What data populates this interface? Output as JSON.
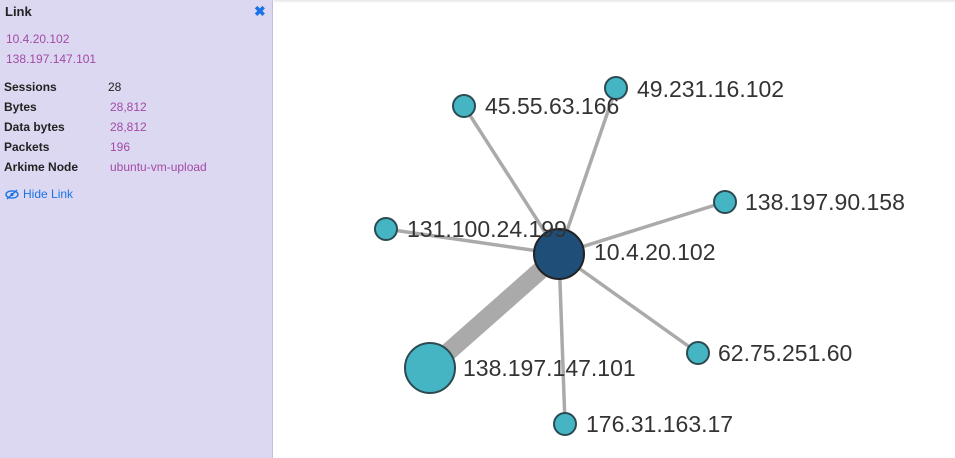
{
  "panel": {
    "title": "Link",
    "close_icon": "close-icon",
    "source_ip": "10.4.20.102",
    "dest_ip": "138.197.147.101",
    "rows": [
      {
        "label": "Sessions",
        "value": "28"
      },
      {
        "label": "Bytes",
        "value": "28,812"
      },
      {
        "label": "Data bytes",
        "value": "28,812"
      },
      {
        "label": "Packets",
        "value": "196"
      },
      {
        "label": "Arkime Node",
        "value": "ubuntu-vm-upload"
      }
    ],
    "hide_link": {
      "icon": "eye-slash-icon",
      "label": "Hide Link"
    }
  },
  "graph": {
    "center_node": {
      "label": "10.4.20.102",
      "color": "#1f4e79"
    },
    "nodes": [
      {
        "label": "45.55.63.166"
      },
      {
        "label": "49.231.16.102"
      },
      {
        "label": "138.197.90.158"
      },
      {
        "label": "131.100.24.199"
      },
      {
        "label": "138.197.147.101"
      },
      {
        "label": "62.75.251.60"
      },
      {
        "label": "176.31.163.17"
      }
    ],
    "colors": {
      "node": "#45b5c4",
      "link": "#aaaaaa",
      "node_stroke": "#2b4a52"
    }
  }
}
